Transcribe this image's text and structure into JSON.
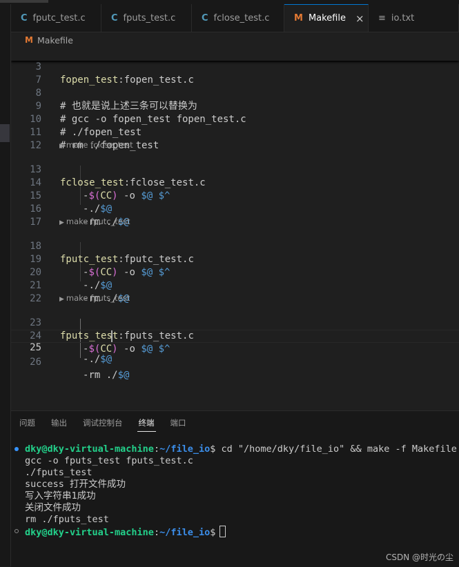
{
  "tabs": [
    {
      "icon": "c-file-icon",
      "glyph": "C",
      "label": "fputc_test.c",
      "active": false
    },
    {
      "icon": "c-file-icon",
      "glyph": "C",
      "label": "fputs_test.c",
      "active": false
    },
    {
      "icon": "c-file-icon",
      "glyph": "C",
      "label": "fclose_test.c",
      "active": false
    },
    {
      "icon": "makefile-icon",
      "glyph": "M",
      "label": "Makefile",
      "active": true
    },
    {
      "icon": "text-file-icon",
      "glyph": "≡",
      "label": "io.txt",
      "active": false
    }
  ],
  "close_glyph": "×",
  "breadcrumb": {
    "glyph": "M",
    "label": "Makefile"
  },
  "sticky": {
    "num": "3",
    "target": "fopen_test",
    "colon": ":",
    "deps": "fopen_test.c"
  },
  "lines": [
    {
      "num": "7"
    },
    {
      "num": "8",
      "comment": "# 也就是说上述三条可以替换为"
    },
    {
      "num": "9",
      "comment": "# gcc -o fopen_test fopen_test.c"
    },
    {
      "num": "10",
      "comment": "# ./fopen_test"
    },
    {
      "num": "11",
      "comment": "# rm ./fopen_test"
    },
    {
      "num": "12"
    },
    {
      "num": "13",
      "target": "fclose_test",
      "colon": ":",
      "deps": "fclose_test.c"
    },
    {
      "num": "14",
      "cmd": "gcc"
    },
    {
      "num": "15",
      "cmd": "run"
    },
    {
      "num": "16",
      "cmd": "rm"
    },
    {
      "num": "17"
    },
    {
      "num": "18",
      "target": "fputc_test",
      "colon": ":",
      "deps": "fputc_test.c"
    },
    {
      "num": "19",
      "cmd": "gcc"
    },
    {
      "num": "20",
      "cmd": "run"
    },
    {
      "num": "21",
      "cmd": "rm"
    },
    {
      "num": "22"
    },
    {
      "num": "23",
      "target": "fputs_test",
      "colon": ":",
      "deps": "fputs_test.c"
    },
    {
      "num": "24",
      "cmd": "gcc"
    },
    {
      "num": "25",
      "cmd": "run"
    },
    {
      "num": "26",
      "cmd": "rm"
    }
  ],
  "recipe": {
    "dash": "-",
    "dollar": "$",
    "open_paren": "(",
    "cc": "CC",
    "close_paren": ")",
    "opt_o": " -o ",
    "target_var": "$@",
    "space": " ",
    "all_deps_var": "$^",
    "run_prefix": "./",
    "rm_prefix": "rm ./"
  },
  "codelens": [
    {
      "play": "▶",
      "label": "make fclose_test"
    },
    {
      "play": "▶",
      "label": "make fputc_test"
    },
    {
      "play": "▶",
      "label": "make fputs_test"
    }
  ],
  "current_line": "25",
  "panel_tabs": [
    {
      "label": "问题",
      "active": false
    },
    {
      "label": "输出",
      "active": false
    },
    {
      "label": "调试控制台",
      "active": false
    },
    {
      "label": "终端",
      "active": true
    },
    {
      "label": "端口",
      "active": false
    }
  ],
  "terminal": {
    "prompt_user": "dky@dky-virtual-machine",
    "prompt_colon": ":",
    "prompt_path": "~/file_io",
    "prompt_end": "$ ",
    "command": "cd \"/home/dky/file_io\" && make -f Makefile fputs_test",
    "output": [
      "gcc -o fputs_test fputs_test.c",
      "./fputs_test",
      "success 打开文件成功",
      "写入字符串1成功",
      "关闭文件成功",
      "rm ./fputs_test"
    ],
    "final_prompt_end": "$"
  },
  "watermark": "CSDN @时光の尘"
}
